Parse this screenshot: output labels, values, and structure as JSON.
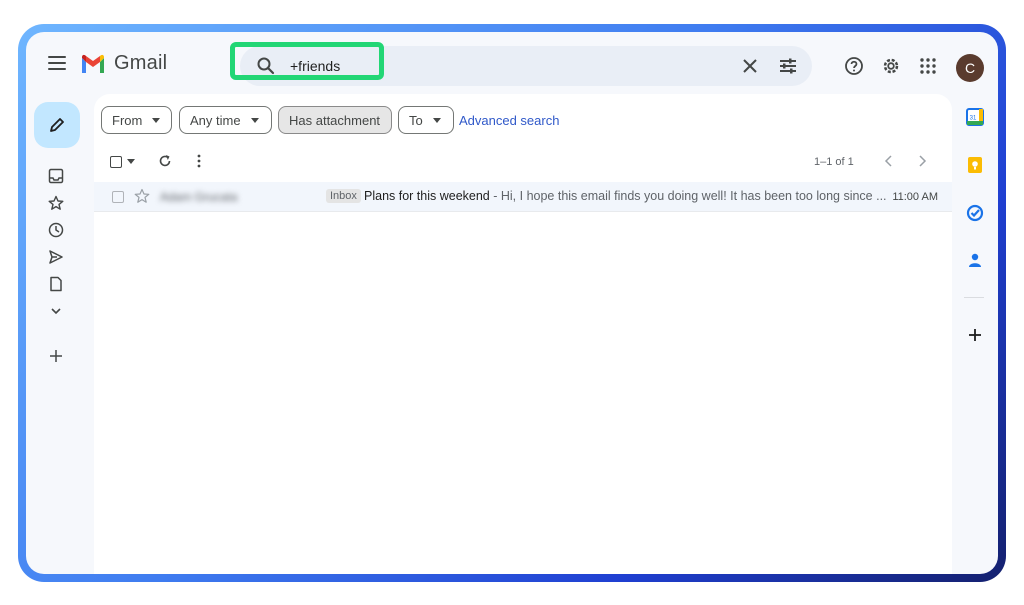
{
  "header": {
    "app_name": "Gmail",
    "search_value": "+friends",
    "avatar_letter": "C"
  },
  "filters": {
    "from": "From",
    "any_time": "Any time",
    "has_attachment": "Has attachment",
    "to": "To",
    "advanced_search": "Advanced search"
  },
  "toolbar": {
    "pagination": "1–1 of 1"
  },
  "emails": [
    {
      "sender": "Adam Grucata",
      "label": "Inbox",
      "subject": "Plans for this weekend",
      "snippet": " - Hi, I hope this email finds you doing well! It has been too long since ...",
      "time": "11:00 AM"
    }
  ],
  "colors": {
    "search_highlight": "#22d675",
    "compose_bg": "#c2e7ff",
    "link": "#3059c9"
  }
}
